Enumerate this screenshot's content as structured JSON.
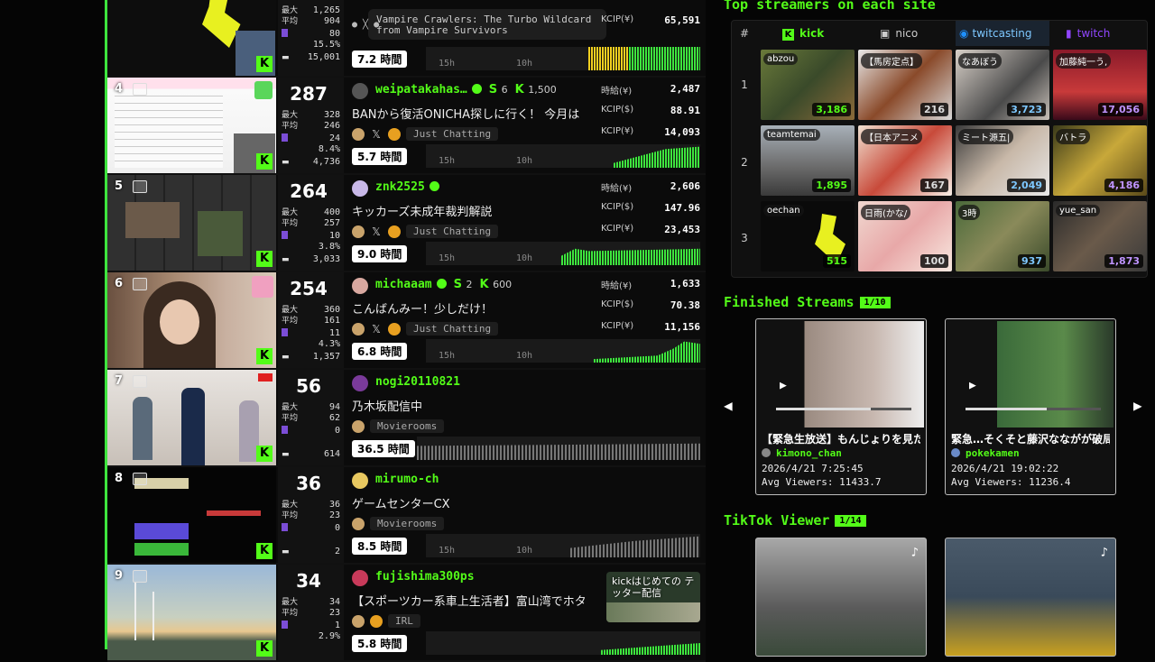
{
  "streams": [
    {
      "rank": "",
      "cur": "",
      "max": "1,265",
      "avg": "904",
      "s3": "80",
      "pct": "15.5%",
      "s5": "15,001",
      "name": "",
      "title": "Vampire Crawlers: The Turbo Wildcard from Vampire Survivors",
      "category": "",
      "hourly": "",
      "kcipusd": "",
      "kcipyen": "65,591",
      "duration": "7.2 時間",
      "t1": "15h",
      "t2": "10h"
    },
    {
      "rank": "4",
      "cur": "287",
      "max": "328",
      "avg": "246",
      "s3": "24",
      "pct": "8.4%",
      "s5": "4,736",
      "name": "weipatakahas…",
      "subs": "6",
      "kfollow": "1,500",
      "title": "BANから復活ONICHA探しに行く！ 今月は",
      "category": "Just Chatting",
      "hourly": "2,487",
      "kcipusd": "88.91",
      "kcipyen": "14,093",
      "duration": "5.7 時間",
      "t1": "15h",
      "t2": "10h"
    },
    {
      "rank": "5",
      "cur": "264",
      "max": "400",
      "avg": "257",
      "s3": "10",
      "pct": "3.8%",
      "s5": "3,033",
      "name": "znk2525",
      "title": "キッカーズ未成年裁判解説",
      "category": "Just Chatting",
      "hourly": "2,606",
      "kcipusd": "147.96",
      "kcipyen": "23,453",
      "duration": "9.0 時間",
      "t1": "15h",
      "t2": "10h"
    },
    {
      "rank": "6",
      "cur": "254",
      "max": "360",
      "avg": "161",
      "s3": "11",
      "pct": "4.3%",
      "s5": "1,357",
      "name": "michaaam",
      "subs": "2",
      "kfollow": "600",
      "title": "こんばんみー！少しだけ！",
      "category": "Just Chatting",
      "hourly": "1,633",
      "kcipusd": "70.38",
      "kcipyen": "11,156",
      "duration": "6.8 時間",
      "t1": "15h",
      "t2": "10h"
    },
    {
      "rank": "7",
      "cur": "56",
      "max": "94",
      "avg": "62",
      "s3": "0",
      "pct": "",
      "s5": "614",
      "name": "nogi20110821",
      "title": "乃木坂配信中",
      "category": "Movierooms",
      "duration": "36.5 時間"
    },
    {
      "rank": "8",
      "cur": "36",
      "max": "36",
      "avg": "23",
      "s3": "0",
      "pct": "",
      "s5": "2",
      "name": "mirumo-ch",
      "title": "ゲームセンターCX",
      "category": "Movierooms",
      "duration": "8.5 時間",
      "t1": "15h",
      "t2": "10h"
    },
    {
      "rank": "9",
      "cur": "34",
      "max": "34",
      "avg": "23",
      "s3": "1",
      "pct": "2.9%",
      "s5": "",
      "name": "fujishima300ps",
      "title": "【スポーツカー系車上生活者】富山湾でホタ",
      "category": "IRL",
      "duration": "5.8 時間",
      "banner": "kickはじめての テッター配信"
    }
  ],
  "labels": {
    "max": "最大",
    "avg": "平均",
    "hourly": "時給(¥)",
    "kcipusd": "KCIP($)",
    "kcipyen": "KCIP(¥)"
  },
  "top": {
    "title": "Top streamers on each site",
    "hash": "#",
    "sites": [
      "kick",
      "nico",
      "twitcasting",
      "twitch"
    ],
    "rows": [
      {
        "n": "1",
        "cells": [
          {
            "name": "abzou",
            "v": "3,186"
          },
          {
            "name": "【馬房定点】",
            "v": "216"
          },
          {
            "name": "なあぼう",
            "v": "3,723"
          },
          {
            "name": "加藤純一う,",
            "v": "17,056"
          }
        ]
      },
      {
        "n": "2",
        "cells": [
          {
            "name": "teamtemai",
            "v": "1,895"
          },
          {
            "name": "【日本アニメ",
            "v": "167"
          },
          {
            "name": "ミート源五|",
            "v": "2,049"
          },
          {
            "name": "バトラ",
            "v": "4,186"
          }
        ]
      },
      {
        "n": "3",
        "cells": [
          {
            "name": "oechan",
            "v": "515"
          },
          {
            "name": "日雨(かな/",
            "v": "100"
          },
          {
            "name": "3時",
            "v": "937"
          },
          {
            "name": "yue_san",
            "v": "1,873"
          }
        ]
      }
    ]
  },
  "finished": {
    "title": "Finished Streams",
    "page": "1/10",
    "cards": [
      {
        "title": "【緊急生放送】もんじょりを見た…",
        "user": "kimono_chan",
        "date": "2026/4/21 7:25:45",
        "avg": "Avg Viewers: 11433.7"
      },
      {
        "title": "緊急…そくそと藤沢なながが破局!…",
        "user": "pokekamen",
        "date": "2026/4/21 19:02:22",
        "avg": "Avg Viewers: 11236.4"
      }
    ]
  },
  "tiktok": {
    "title": "TikTok Viewer",
    "page": "1/14"
  },
  "icons": {
    "prev": "◀",
    "next": "▶",
    "kick": "K",
    "x": "𝕏",
    "nico": "▣",
    "twitcasting": "◉",
    "twitch": "▮"
  },
  "colors": {
    "accent": "#53fc18",
    "twitch": "#9146ff",
    "twitcasting": "#1e90ff"
  }
}
